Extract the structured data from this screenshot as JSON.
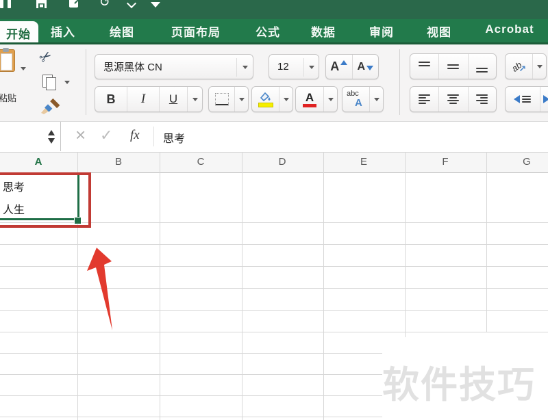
{
  "title_bar": {
    "icon_names": [
      "window-icon",
      "save-icon",
      "share-icon",
      "undo-icon",
      "caret-icon",
      "menu-down-icon"
    ]
  },
  "ribbon": {
    "tabs": [
      {
        "label": "开始",
        "active": true
      },
      {
        "label": "插入"
      },
      {
        "label": "绘图"
      },
      {
        "label": "页面布局"
      },
      {
        "label": "公式"
      },
      {
        "label": "数据"
      },
      {
        "label": "审阅"
      },
      {
        "label": "视图"
      },
      {
        "label": "Acrobat"
      }
    ]
  },
  "toolbar": {
    "paste_label": "粘贴",
    "font_name": "思源黑体 CN",
    "font_size": "12",
    "bold": "B",
    "italic": "I",
    "underline": "U",
    "grow_letter": "A",
    "shrink_letter": "A",
    "font_color_letter": "A",
    "case_small": "abc",
    "case_big": "A",
    "orient_label": "ab",
    "orient_arrow": "↗"
  },
  "icons": {
    "scissors": "✂",
    "undo": "↺"
  },
  "formula_bar": {
    "cancel": "×",
    "confirm": "✓",
    "fx_label": "fx",
    "value": "思考"
  },
  "sheet": {
    "column_headers": [
      "A",
      "B",
      "C",
      "D",
      "E",
      "F",
      "G"
    ],
    "selected_column": "A",
    "cell_a1": {
      "line1": "思考",
      "line2": "人生"
    }
  },
  "watermark": {
    "text": "软件技巧"
  },
  "colors": {
    "title_bar_green": "#2a684a",
    "tab_bar_green": "#227a4b",
    "active_tab_text": "#1e6b40",
    "selection_green": "#1e6e46",
    "annotation_red": "#c13a34",
    "arrow_red": "#e23a2e",
    "fill_yellow": "#f5ee00",
    "font_color_red": "#e02222",
    "blue_accent": "#4a86c8",
    "watermark_gray": "#e1e1e1"
  }
}
